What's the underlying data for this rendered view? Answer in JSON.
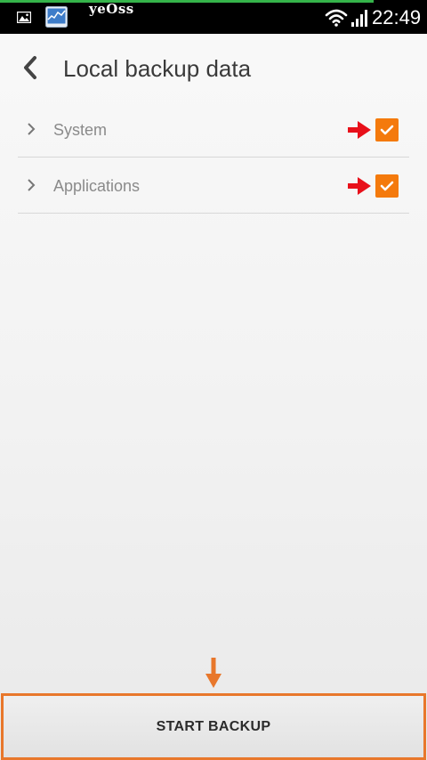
{
  "status_bar": {
    "watermark": "yeOss",
    "time": "22:49",
    "icons": [
      "gallery-icon",
      "chart-app-icon",
      "wifi-icon",
      "signal-icon"
    ]
  },
  "header": {
    "back_icon": "back-chevron-icon",
    "title": "Local backup data"
  },
  "list": {
    "items": [
      {
        "label": "System",
        "checked": true
      },
      {
        "label": "Applications",
        "checked": true
      }
    ]
  },
  "footer": {
    "start_label": "START BACKUP"
  },
  "colors": {
    "checkbox": "#f47a0c",
    "annotation_red": "#e8101a",
    "annotation_orange": "#e8772b",
    "title_text": "#3a3a3a",
    "item_text": "#8a8a8a"
  }
}
